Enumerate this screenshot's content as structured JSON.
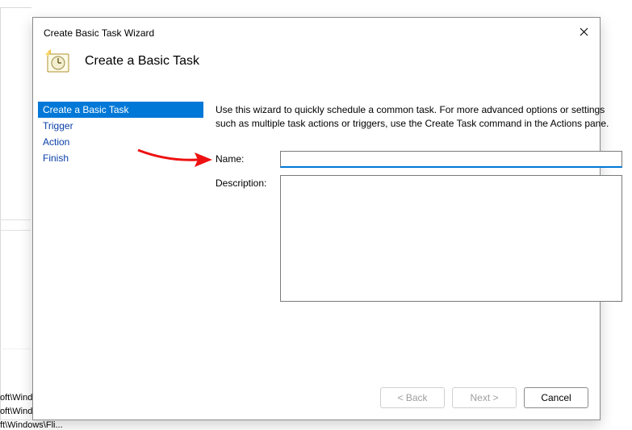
{
  "bg": {
    "line1": "oft\\Windo",
    "line2": "oft\\Windows\\U...",
    "line3": "ft\\Windows\\Fli..."
  },
  "dialog": {
    "title": "Create Basic Task Wizard",
    "heading": "Create a Basic Task",
    "steps": [
      "Create a Basic Task",
      "Trigger",
      "Action",
      "Finish"
    ],
    "instruction": "Use this wizard to quickly schedule a common task.  For more advanced options or settings such as multiple task actions or triggers, use the Create Task command in the Actions pane.",
    "name_label": "Name:",
    "name_value": "",
    "desc_label": "Description:",
    "desc_value": "",
    "buttons": {
      "back": "< Back",
      "next": "Next >",
      "cancel": "Cancel"
    }
  }
}
